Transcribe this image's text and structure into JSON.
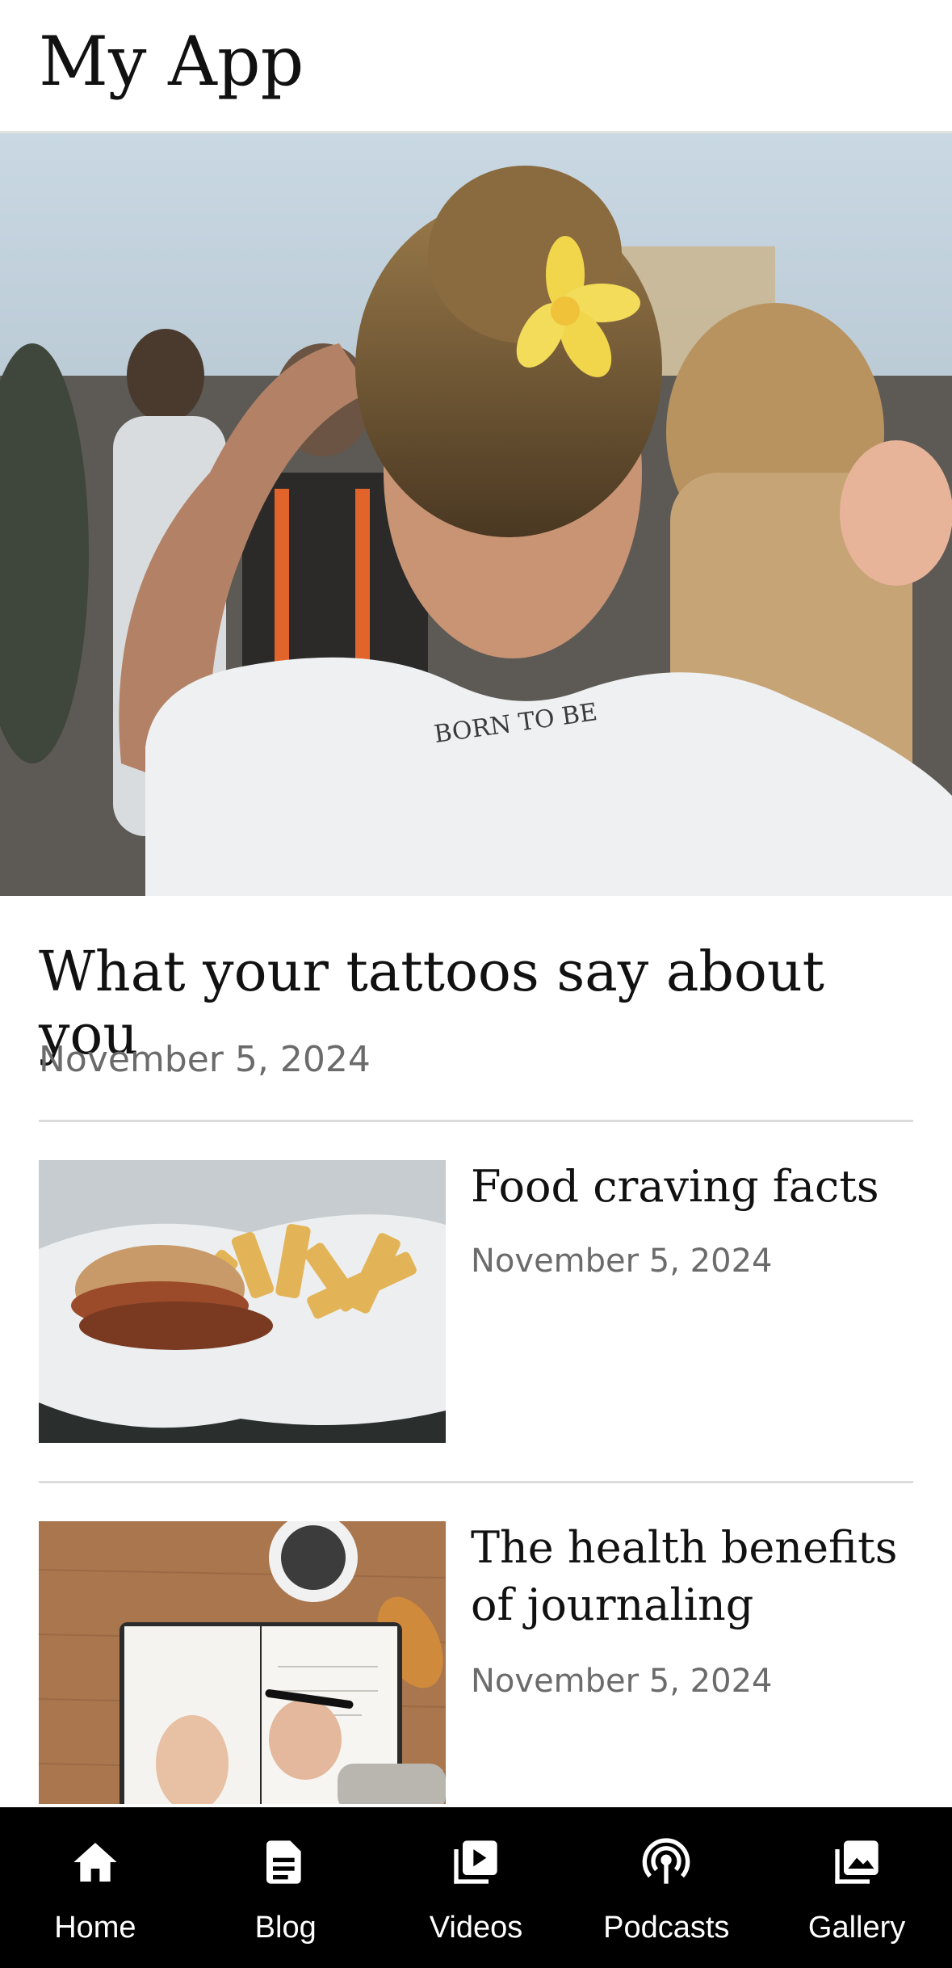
{
  "header": {
    "title": "My App"
  },
  "featured": {
    "title": "What your tattoos say about you",
    "date": "November 5, 2024",
    "image_icon": "photo-festival-tattoo"
  },
  "articles": [
    {
      "title": "Food craving facts",
      "date": "November 5, 2024",
      "image_icon": "photo-burger-fries"
    },
    {
      "title": "The health benefits of journaling",
      "date": "November 5, 2024",
      "image_icon": "photo-journal-writing"
    }
  ],
  "tabs": [
    {
      "label": "Home",
      "icon": "home-icon"
    },
    {
      "label": "Blog",
      "icon": "blog-icon"
    },
    {
      "label": "Videos",
      "icon": "videos-icon"
    },
    {
      "label": "Podcasts",
      "icon": "podcasts-icon"
    },
    {
      "label": "Gallery",
      "icon": "gallery-icon"
    }
  ],
  "colors": {
    "tabbar_bg": "#000000",
    "date_text": "#6b6b6b",
    "divider": "#dcdcdc"
  }
}
